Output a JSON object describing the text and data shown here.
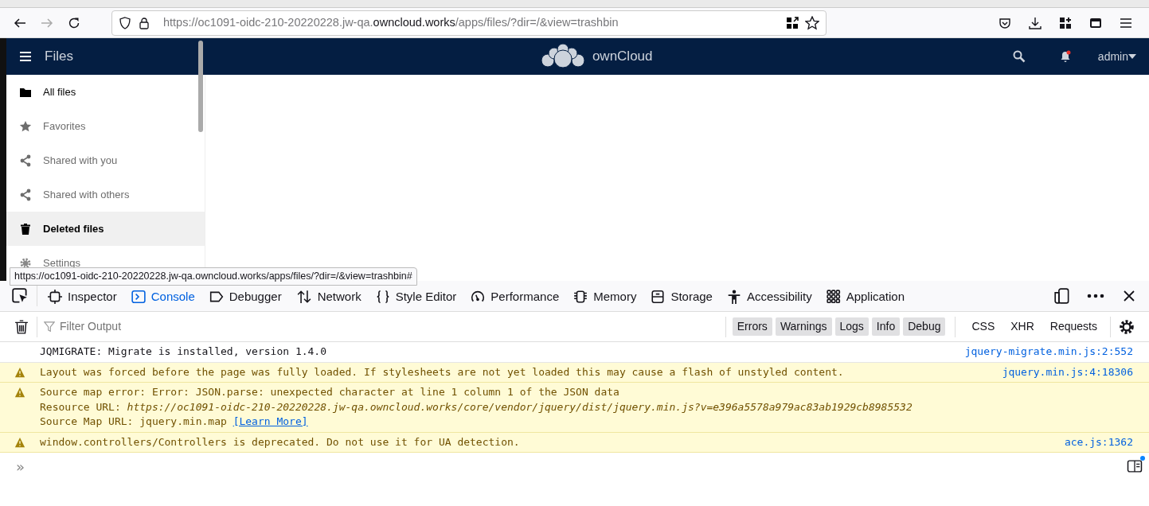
{
  "browser": {
    "url_prefix": "https://oc1091-oidc-210-20220228.jw-qa.",
    "url_domain": "owncloud.works",
    "url_suffix": "/apps/files/?dir=/&view=trashbin"
  },
  "app_header": {
    "title": "Files",
    "logo_text": "ownCloud",
    "user": "admin",
    "notification": true
  },
  "sidebar": {
    "items": [
      {
        "label": "All files",
        "selected": false,
        "emphasized": true
      },
      {
        "label": "Favorites",
        "selected": false,
        "emphasized": false
      },
      {
        "label": "Shared with you",
        "selected": false,
        "emphasized": false
      },
      {
        "label": "Shared with others",
        "selected": false,
        "emphasized": false
      },
      {
        "label": "Deleted files",
        "selected": true,
        "emphasized": true
      },
      {
        "label": "Settings",
        "selected": false,
        "emphasized": false
      }
    ]
  },
  "status_link": "https://oc1091-oidc-210-20220228.jw-qa.owncloud.works/apps/files/?dir=/&view=trashbin#",
  "devtools": {
    "tabs": [
      {
        "label": "Inspector",
        "selected": false
      },
      {
        "label": "Console",
        "selected": true
      },
      {
        "label": "Debugger",
        "selected": false
      },
      {
        "label": "Network",
        "selected": false
      },
      {
        "label": "Style Editor",
        "selected": false
      },
      {
        "label": "Performance",
        "selected": false
      },
      {
        "label": "Memory",
        "selected": false
      },
      {
        "label": "Storage",
        "selected": false
      },
      {
        "label": "Accessibility",
        "selected": false
      },
      {
        "label": "Application",
        "selected": false
      }
    ],
    "filter_placeholder": "Filter Output",
    "level_filters": [
      {
        "label": "Errors",
        "selected": true
      },
      {
        "label": "Warnings",
        "selected": true
      },
      {
        "label": "Logs",
        "selected": true
      },
      {
        "label": "Info",
        "selected": true
      },
      {
        "label": "Debug",
        "selected": true
      }
    ],
    "type_filters": [
      {
        "label": "CSS",
        "selected": false
      },
      {
        "label": "XHR",
        "selected": false
      },
      {
        "label": "Requests",
        "selected": false
      }
    ],
    "messages": [
      {
        "kind": "log",
        "lines": [
          {
            "text": "JQMIGRATE: Migrate is installed, version 1.4.0"
          }
        ],
        "source": "jquery-migrate.min.js:2:552"
      },
      {
        "kind": "warning",
        "lines": [
          {
            "text": "Layout was forced before the page was fully loaded. If stylesheets are not yet loaded this may cause a flash of unstyled content."
          }
        ],
        "source": "jquery.min.js:4:18306"
      },
      {
        "kind": "warning",
        "lines": [
          {
            "text": "Source map error: Error: JSON.parse: unexpected character at line 1 column 1 of the JSON data"
          },
          {
            "text": "Resource URL: *https://oc1091-oidc-210-20220228.jw-qa.owncloud.works/core/vendor/jquery/dist/jquery.min.js?v=e396a5578a979ac83ab1929cb8985532*"
          },
          {
            "text": "Source Map URL: jquery.min.map",
            "link": "[Learn More]"
          }
        ]
      },
      {
        "kind": "warning",
        "lines": [
          {
            "text": "window.controllers/Controllers is deprecated. Do not use it for UA detection."
          }
        ],
        "source": "ace.js:1362"
      }
    ],
    "prompt": "»"
  }
}
